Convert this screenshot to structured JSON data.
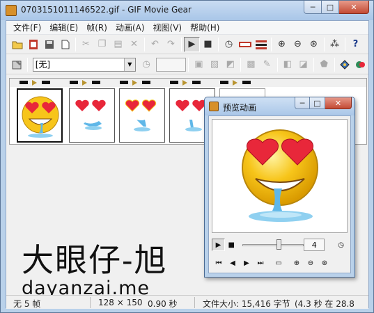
{
  "window": {
    "title": "0703151011146522.gif - GIF Movie Gear",
    "minimize": "─",
    "maximize": "□",
    "close": "✕"
  },
  "menu": [
    "文件(F)",
    "编辑(E)",
    "帧(R)",
    "动画(A)",
    "视图(V)",
    "帮助(H)"
  ],
  "toolbar2": {
    "transparency_select": "[无]",
    "delay_value": ""
  },
  "preview_window": {
    "title": "预览动画",
    "frame_number": "4",
    "playback_progress": 0.6,
    "minimize": "─",
    "maximize": "□",
    "close": "✕"
  },
  "frames": {
    "count": 5,
    "selected_index": 0
  },
  "watermark": {
    "chinese": "大眼仔-旭",
    "site": "dayanzai.me"
  },
  "statusbar": {
    "frames": "无 5 帧",
    "dimensions": "128 × 150",
    "delay": "0.90 秒",
    "filesize": "文件大小: 15,416 字节",
    "time": "(4.3 秒 在 28.8"
  },
  "colors": {
    "titlebar": "#b9d1ea",
    "face_yellow": "#f7c51a",
    "heart_red": "#e8273a",
    "drool_blue": "#5fb7e8"
  }
}
